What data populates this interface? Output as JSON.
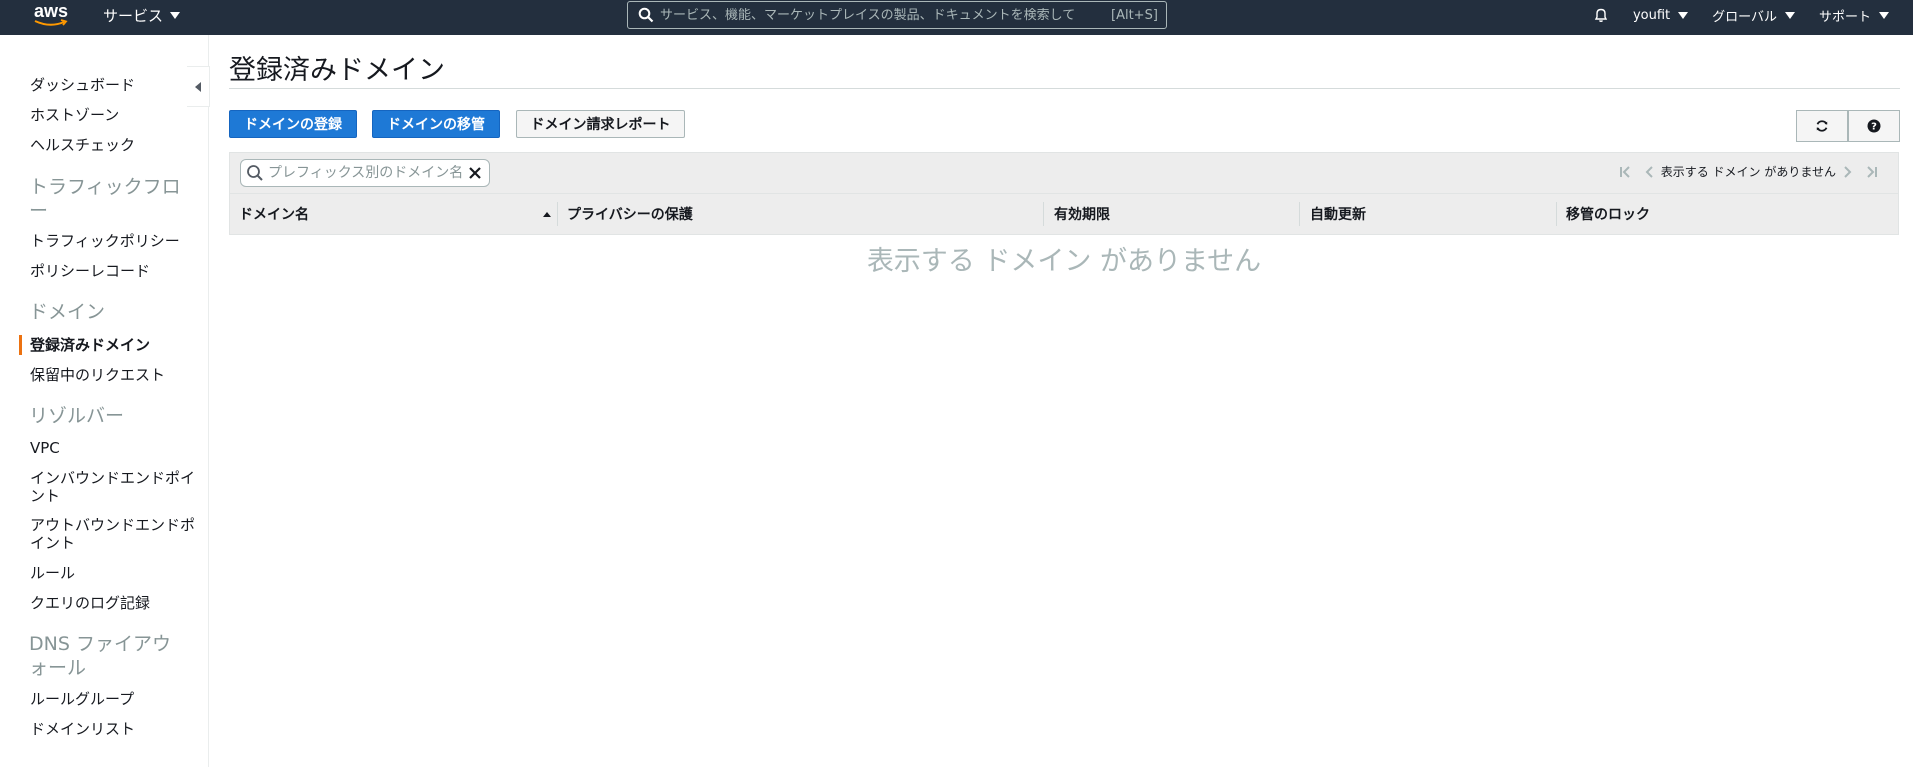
{
  "topnav": {
    "logo_text": "aws",
    "services_label": "サービス",
    "search_placeholder": "サービス、機能、マーケットプレイスの製品、ドキュメントを検索して",
    "search_shortcut": "[Alt+S]",
    "account_label": "youfit",
    "region_label": "グローバル",
    "support_label": "サポート"
  },
  "sidebar": {
    "items": {
      "dashboard": "ダッシュボード",
      "hosted_zones": "ホストゾーン",
      "health_checks": "ヘルスチェック",
      "section_traffic_flow": "トラフィックフロー",
      "traffic_policies": "トラフィックポリシー",
      "policy_records": "ポリシーレコード",
      "section_domains": "ドメイン",
      "registered_domains": "登録済みドメイン",
      "pending_requests": "保留中のリクエスト",
      "section_resolver": "リゾルバー",
      "vpc": "VPC",
      "inbound_endpoints": "インバウンドエンドポイント",
      "outbound_endpoints": "アウトバウンドエンドポイント",
      "rules": "ルール",
      "query_logging": "クエリのログ記録",
      "section_dns_firewall": "DNS ファイアウォール",
      "rule_groups": "ルールグループ",
      "domain_lists": "ドメインリスト"
    }
  },
  "main": {
    "title": "登録済みドメイン",
    "buttons": {
      "register": "ドメインの登録",
      "transfer": "ドメインの移管",
      "billing_report": "ドメイン請求レポート"
    },
    "filter_placeholder": "プレフィックス別のドメイン名でフィルタリング",
    "pager_text": "表示する ドメイン がありません",
    "columns": [
      "ドメイン名",
      "プライバシーの保護",
      "有効期限",
      "自動更新",
      "移管のロック"
    ],
    "empty_message": "表示する ドメイン がありません"
  },
  "colors": {
    "topbar": "#232f3e",
    "primary_button": "#1e79d6",
    "active_accent": "#ec7211"
  }
}
